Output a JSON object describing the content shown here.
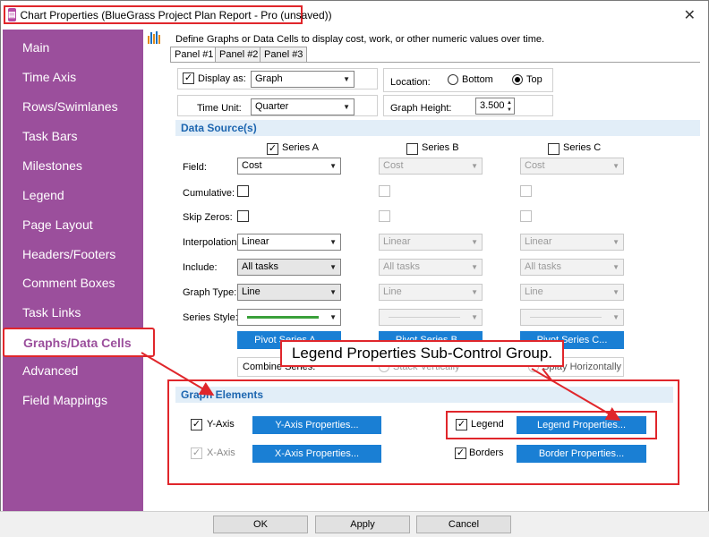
{
  "window": {
    "title": "Chart Properties (BlueGrass Project Plan Report - Pro (unsaved))",
    "close": "✕"
  },
  "sidebar": {
    "items": [
      "Main",
      "Time Axis",
      "Rows/Swimlanes",
      "Task Bars",
      "Milestones",
      "Legend",
      "Page Layout",
      "Headers/Footers",
      "Comment Boxes",
      "Task Links",
      "Graphs/Data Cells",
      "Advanced",
      "Field Mappings"
    ],
    "active": "Graphs/Data Cells"
  },
  "header": {
    "description": "Define Graphs or Data Cells to display cost, work, or other numeric values over time."
  },
  "tabs": [
    "Panel #1",
    "Panel #2",
    "Panel #3"
  ],
  "panel": {
    "display_as_label": "Display as:",
    "display_as_value": "Graph",
    "location_label": "Location:",
    "location_bottom": "Bottom",
    "location_top": "Top",
    "time_unit_label": "Time Unit:",
    "time_unit_value": "Quarter",
    "graph_height_label": "Graph Height:",
    "graph_height_value": "3.500"
  },
  "data_source": {
    "section_title": "Data Source(s)",
    "series": [
      "Series A",
      "Series B",
      "Series C"
    ],
    "row_labels": {
      "field": "Field:",
      "cumulative": "Cumulative:",
      "skip_zeros": "Skip Zeros:",
      "interpolation": "Interpolation:",
      "include": "Include:",
      "graph_type": "Graph Type:",
      "series_style": "Series Style:"
    },
    "field_value": "Cost",
    "interpolation_value": "Linear",
    "include_value": "All tasks",
    "graph_type_value": "Line",
    "pivot_a": "Pivot Series A...",
    "pivot_b": "Pivot Series B...",
    "pivot_c": "Pivot Series C...",
    "combine_label": "Combine Series:",
    "stack_vertically": "Stack Vertically",
    "splay_horizontally": "Splay Horizontally"
  },
  "graph_elements": {
    "section_title": "Graph Elements",
    "y_axis_label": "Y-Axis",
    "y_axis_button": "Y-Axis Properties...",
    "x_axis_label": "X-Axis",
    "x_axis_button": "X-Axis Properties...",
    "legend_label": "Legend",
    "legend_button": "Legend Properties...",
    "borders_label": "Borders",
    "borders_button": "Border Properties..."
  },
  "callout": {
    "text": "Legend Properties Sub-Control Group."
  },
  "footer": {
    "ok": "OK",
    "apply": "Apply",
    "cancel": "Cancel"
  },
  "colors": {
    "sidebar": "#9b4f9c",
    "accent": "#1a7fd4",
    "highlight": "#e0262b",
    "section_title": "#1d66b0"
  }
}
